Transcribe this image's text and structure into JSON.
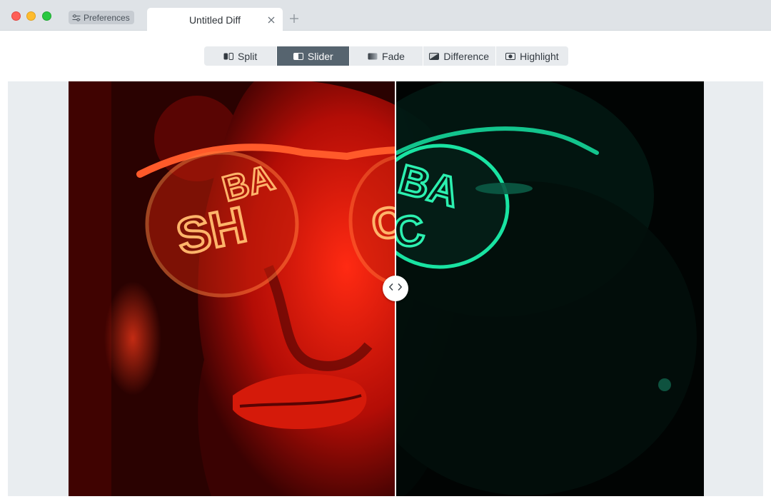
{
  "window": {
    "controls": [
      "close",
      "minimize",
      "zoom"
    ]
  },
  "toolbar": {
    "preferences_label": "Preferences",
    "preferences_icon": "sliders-icon"
  },
  "tabs": [
    {
      "label": "Untitled Diff",
      "active": true
    }
  ],
  "new_tab_icon": "plus-icon",
  "modes": [
    {
      "id": "split",
      "label": "Split",
      "icon": "split-icon",
      "active": false
    },
    {
      "id": "slider",
      "label": "Slider",
      "icon": "slider-icon",
      "active": true
    },
    {
      "id": "fade",
      "label": "Fade",
      "icon": "fade-icon",
      "active": false
    },
    {
      "id": "difference",
      "label": "Difference",
      "icon": "difference-icon",
      "active": false
    },
    {
      "id": "highlight",
      "label": "Highlight",
      "icon": "highlight-icon",
      "active": false
    }
  ],
  "comparison": {
    "slider_position": 0.515,
    "before_tint": "#ff1a0a",
    "after_tint": "#1fd39a"
  },
  "colors": {
    "accent": "#56646f",
    "titlebar": "#dfe3e7",
    "canvas_bg": "#e9edf0"
  }
}
